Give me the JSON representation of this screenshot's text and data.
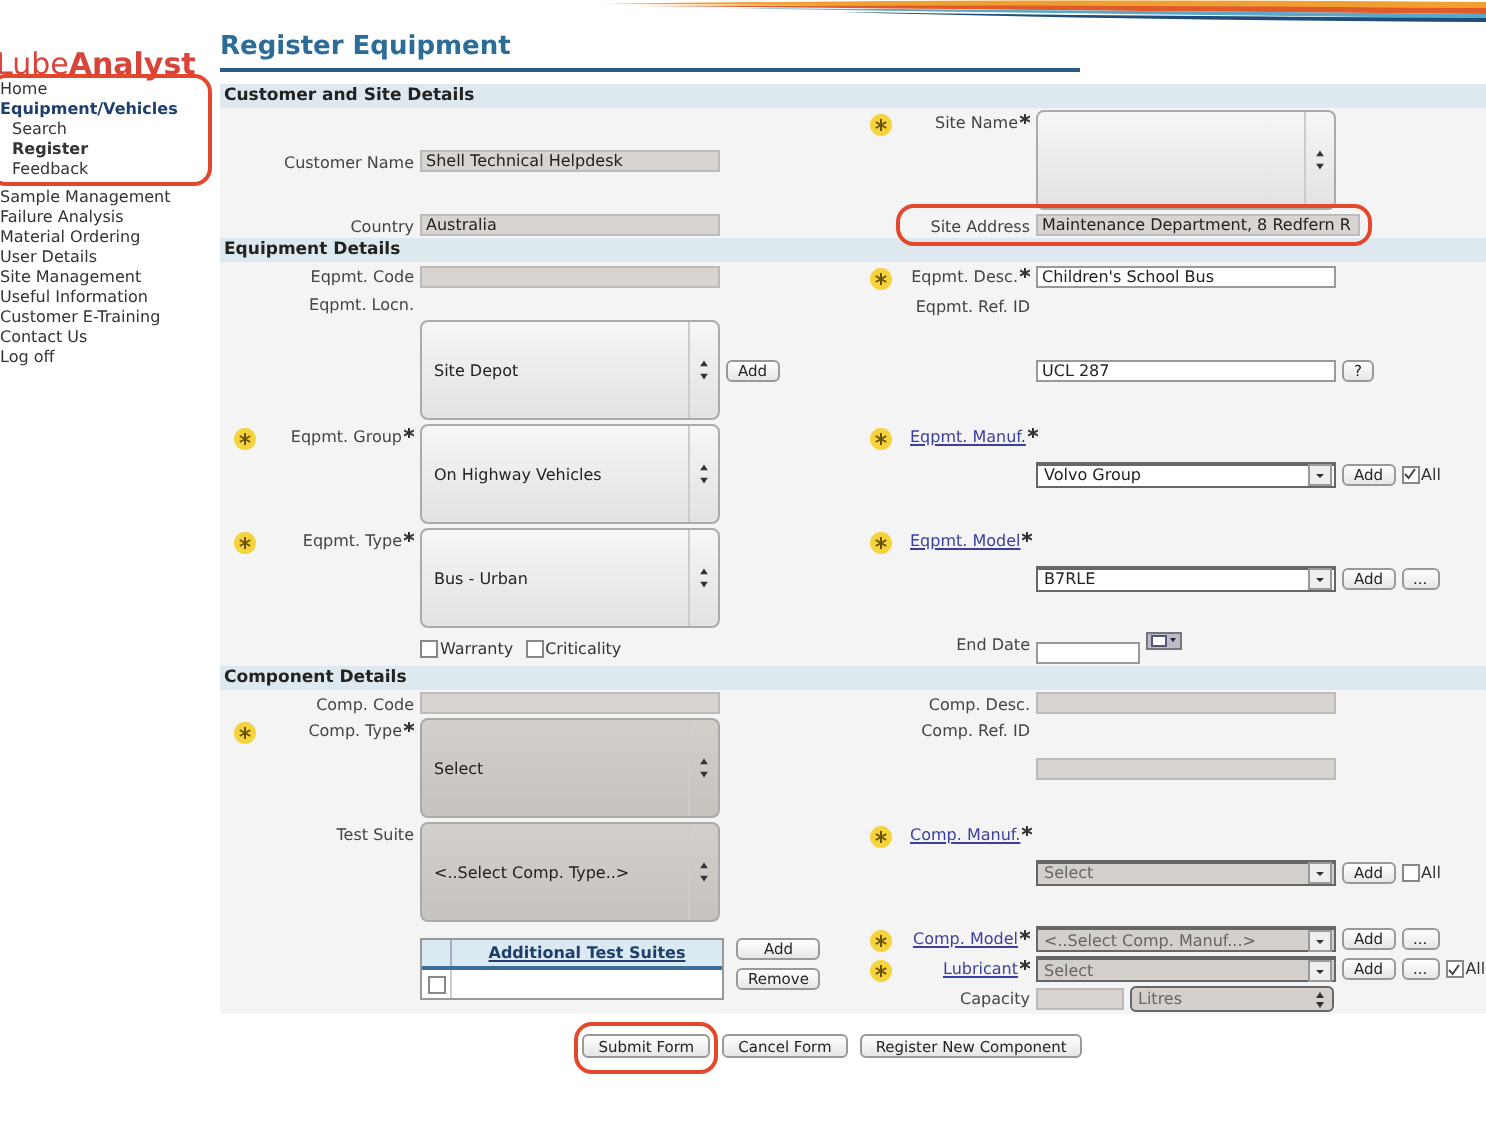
{
  "logo": "Lube**Analyst**",
  "sidebar": {
    "items": [
      {
        "label": "Home",
        "selected": false,
        "circled": true
      },
      {
        "label": "Equipment/Vehicles",
        "selected": true,
        "circled": true,
        "children": [
          {
            "label": "Search",
            "selected": false
          },
          {
            "label": "Register",
            "selected": true
          },
          {
            "label": "Feedback",
            "selected": false
          }
        ]
      },
      {
        "label": "Sample Management",
        "selected": false,
        "circled": false
      },
      {
        "label": "Failure Analysis",
        "selected": false,
        "circled": false
      },
      {
        "label": "Material Ordering",
        "selected": false,
        "circled": false
      },
      {
        "label": "User Details",
        "selected": false,
        "circled": false
      },
      {
        "label": "Site Management",
        "selected": false,
        "circled": false
      },
      {
        "label": "Useful Information",
        "selected": false,
        "circled": false
      },
      {
        "label": "Customer E-Training",
        "selected": false,
        "circled": false
      },
      {
        "label": "Contact Us",
        "selected": false,
        "circled": false
      },
      {
        "label": "Log off",
        "selected": false,
        "circled": false
      }
    ]
  },
  "title": "Register Equipment",
  "sections": [
    {
      "title": "Customer and Site Details",
      "rows": [
        {
          "left": [
            {
              "kind": "text",
              "label": "Customer Name",
              "value": "Shell Technical Helpdesk",
              "disabled": true
            }
          ],
          "right": [
            {
              "kind": "listbox",
              "label": "Site Name",
              "required": true,
              "disabled": false
            }
          ]
        },
        {
          "left": [
            {
              "kind": "text",
              "label": "Country",
              "value": "Australia",
              "disabled": true
            }
          ],
          "right": [
            {
              "kind": "text",
              "label": "Site Address",
              "value": "Maintenance Department, 8 Redfern R",
              "disabled": true,
              "circled": true
            }
          ]
        }
      ]
    },
    {
      "title": "Equipment Details",
      "rows": [
        {
          "left": [
            {
              "kind": "text",
              "label": "Eqpmt. Code",
              "disabled": true
            },
            {
              "kind": "label",
              "label": "Eqpmt. Locn."
            }
          ],
          "right": [
            {
              "kind": "text",
              "label": "Eqpmt. Desc.",
              "required": true,
              "value": "Children's School Bus",
              "disabled": false
            },
            {
              "kind": "label",
              "label": "Eqpmt. Ref. ID"
            }
          ]
        },
        {
          "left": [
            {
              "kind": "listbox",
              "value": "Site Depot",
              "disabled": false,
              "buttons": [
                "Add"
              ]
            }
          ],
          "right": [
            {
              "kind": "text",
              "value": "UCL 287",
              "disabled": false,
              "buttons": [
                "?"
              ]
            }
          ]
        },
        {
          "left": [
            {
              "kind": "listbox",
              "label": "Eqpmt. Group",
              "required": true,
              "value": "On Highway Vehicles",
              "disabled": false
            }
          ],
          "right": [
            {
              "kind": "select",
              "label": "Eqpmt. Manuf.",
              "link": true,
              "required": true,
              "value": "Volvo Group",
              "disabled": false,
              "buttons": [
                "Add"
              ],
              "all": {
                "label": "All",
                "checked": true
              }
            }
          ]
        },
        {
          "left": [
            {
              "kind": "listbox",
              "label": "Eqpmt. Type",
              "required": true,
              "value": "Bus - Urban",
              "disabled": false
            }
          ],
          "right": [
            {
              "kind": "select",
              "label": "Eqpmt. Model",
              "link": true,
              "required": true,
              "value": "B7RLE",
              "disabled": false,
              "buttons": [
                "Add",
                "..."
              ]
            }
          ]
        },
        {
          "left": [
            {
              "kind": "checkboxes",
              "options": [
                {
                  "label": "Warranty",
                  "checked": false
                },
                {
                  "label": "Criticality",
                  "checked": false
                }
              ]
            }
          ],
          "right": [
            {
              "kind": "date",
              "label": "End Date"
            }
          ]
        }
      ]
    },
    {
      "title": "Component Details",
      "rows": [
        {
          "left": [
            {
              "kind": "text",
              "label": "Comp. Code",
              "disabled": true
            }
          ],
          "right": [
            {
              "kind": "text",
              "label": "Comp. Desc.",
              "disabled": true
            }
          ]
        },
        {
          "left": [
            {
              "kind": "listbox",
              "label": "Comp. Type",
              "required": true,
              "value": "Select",
              "disabled": true
            }
          ],
          "right": [
            {
              "kind": "text",
              "label": "Comp. Ref. ID",
              "disabled": true
            }
          ]
        },
        {
          "left": [
            {
              "kind": "listbox",
              "label": "Test Suite",
              "value": "<..Select Comp. Type..>",
              "disabled": true
            }
          ],
          "right": [
            {
              "kind": "select",
              "label": "Comp. Manuf.",
              "link": true,
              "required": true,
              "value": "Select",
              "disabled": true,
              "buttons": [
                "Add"
              ],
              "all": {
                "label": "All",
                "checked": false
              }
            }
          ]
        },
        {
          "left": [
            {
              "kind": "table",
              "heading": "Additional Test Suites",
              "checked": false,
              "buttons": [
                "Add",
                "Remove"
              ]
            }
          ],
          "right": [
            {
              "kind": "select",
              "label": "Comp. Model",
              "link": true,
              "required": true,
              "value": "<..Select Comp. Manuf...>",
              "disabled": true,
              "buttons": [
                "Add",
                "..."
              ]
            },
            {
              "kind": "select",
              "label": "Lubricant",
              "link": true,
              "required": true,
              "value": "Select",
              "disabled": true,
              "buttons": [
                "Add",
                "..."
              ],
              "all": {
                "label": "All",
                "checked": true
              }
            },
            {
              "kind": "capacity",
              "label": "Capacity",
              "unit": "Litres",
              "disabled": true
            }
          ]
        }
      ]
    }
  ],
  "actions": [
    {
      "label": "Submit Form",
      "circled": true
    },
    {
      "label": "Cancel Form",
      "circled": false
    },
    {
      "label": "Register New Component",
      "circled": false
    }
  ]
}
